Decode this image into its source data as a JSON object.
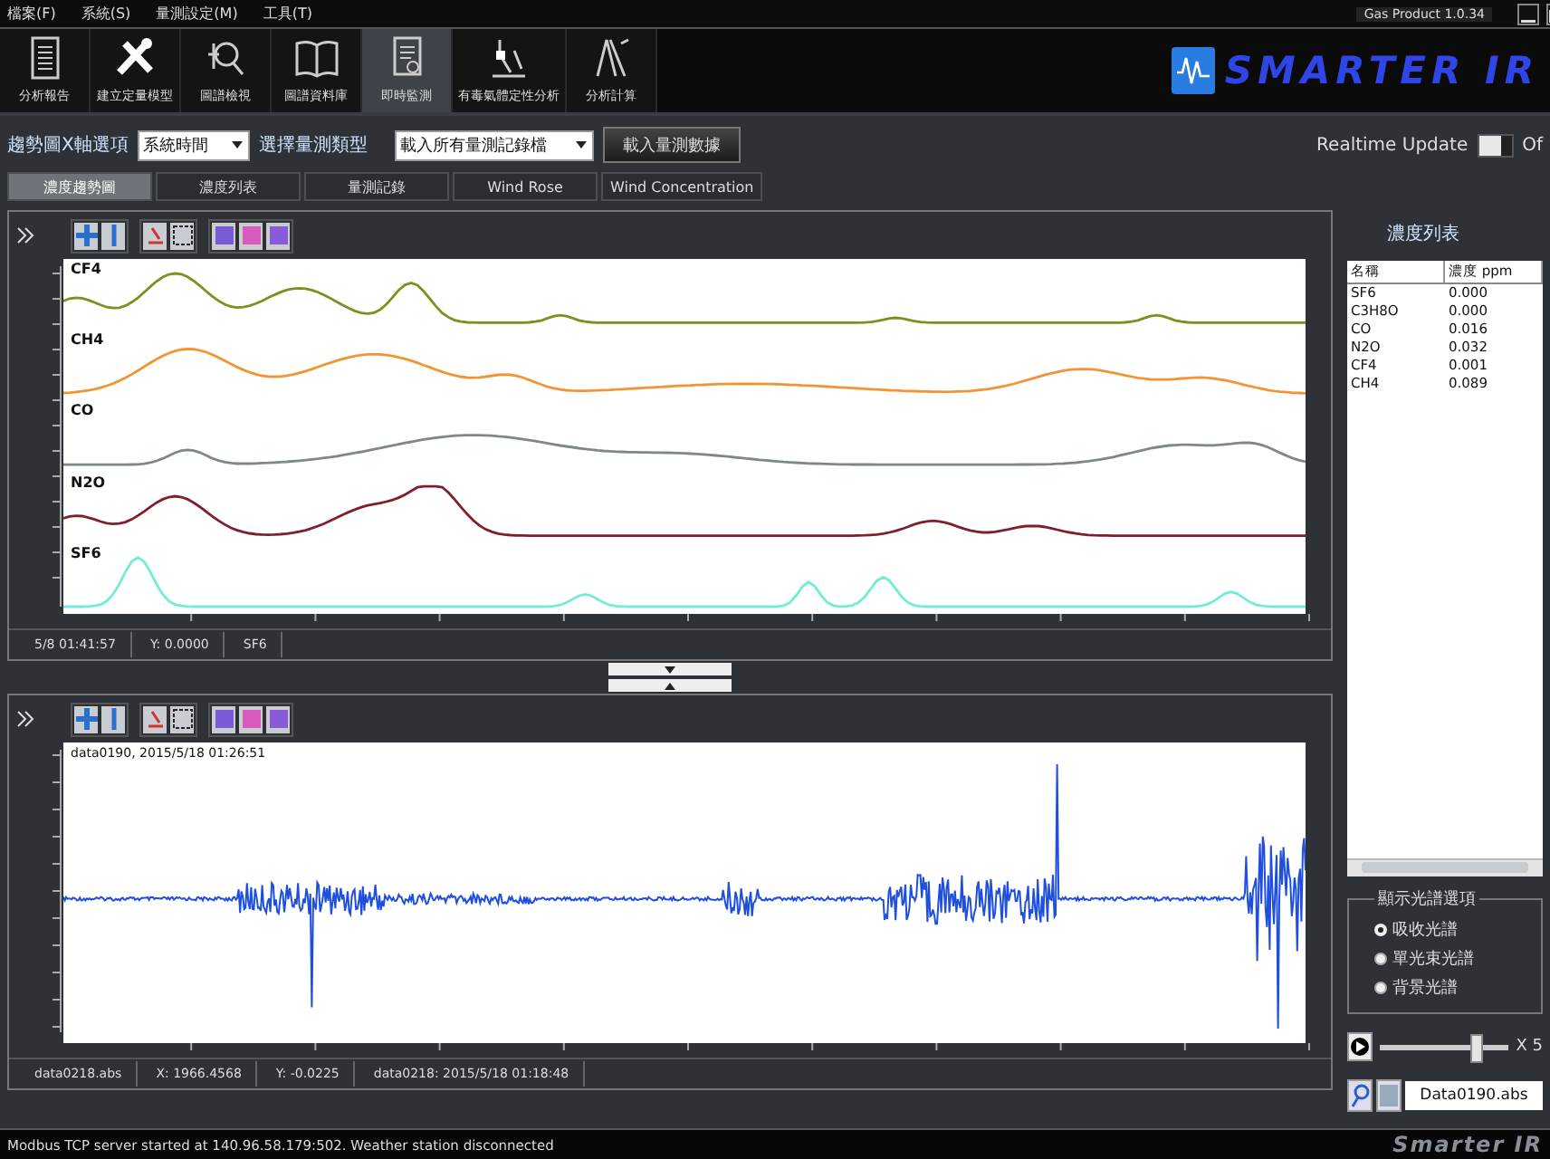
{
  "menu": [
    "檔案(F)",
    "系統(S)",
    "量測設定(M)",
    "工具(T)"
  ],
  "version": "Gas Product 1.0.34",
  "toolbar": [
    {
      "label": "分析報告",
      "selected": false
    },
    {
      "label": "建立定量模型",
      "selected": false
    },
    {
      "label": "圖譜檢視",
      "selected": false
    },
    {
      "label": "圖譜資料庫",
      "selected": false
    },
    {
      "label": "即時監測",
      "selected": true
    },
    {
      "label": "有毒氣體定性分析",
      "selected": false
    },
    {
      "label": "分析計算",
      "selected": false
    }
  ],
  "logo": "SMARTER IR",
  "controls": {
    "x_axis_label": "趨勢圖X軸選項",
    "x_axis_value": "系統時間",
    "type_label": "選擇量測類型",
    "type_value": "載入所有量測記錄檔",
    "load_button": "載入量測數據"
  },
  "realtime": {
    "label": "Realtime Update",
    "on": false,
    "state_text": "Of"
  },
  "tabs": [
    {
      "label": "濃度趨勢圖",
      "selected": true
    },
    {
      "label": "濃度列表",
      "selected": false
    },
    {
      "label": "量測記錄",
      "selected": false
    },
    {
      "label": "Wind Rose",
      "selected": false
    },
    {
      "label": "Wind Concentration",
      "selected": false
    }
  ],
  "trend_chart": {
    "series": [
      {
        "name": "CF4",
        "color": "#7f8f1f"
      },
      {
        "name": "CH4",
        "color": "#f39433"
      },
      {
        "name": "CO",
        "color": "#7f8788"
      },
      {
        "name": "N2O",
        "color": "#7f1f2a"
      },
      {
        "name": "SF6",
        "color": "#72ecd4"
      }
    ],
    "status": [
      "5/8 01:41:57",
      "Y: 0.0000",
      "SF6"
    ]
  },
  "spectrum_chart": {
    "legend": "data0190, 2015/5/18 01:26:51",
    "status": [
      "data0218.abs",
      "X: 1966.4568",
      "Y: -0.0225",
      "data0218: 2015/5/18 01:18:48"
    ]
  },
  "concentration_list": {
    "title": "濃度列表",
    "columns": [
      "名稱",
      "濃度 ppm"
    ],
    "rows": [
      [
        "SF6",
        "0.000"
      ],
      [
        "C3H8O",
        "0.000"
      ],
      [
        "CO",
        "0.016"
      ],
      [
        "N2O",
        "0.032"
      ],
      [
        "CF4",
        "0.001"
      ],
      [
        "CH4",
        "0.089"
      ]
    ]
  },
  "spectrum_options": {
    "title": "顯示光譜選項",
    "options": [
      {
        "label": "吸收光譜",
        "selected": true
      },
      {
        "label": "單光束光譜",
        "selected": false
      },
      {
        "label": "背景光譜",
        "selected": false
      }
    ]
  },
  "playback": {
    "speed": "X 5",
    "level": 0.75
  },
  "file": "Data0190.abs",
  "status_bar": "Modbus TCP server started at 140.96.58.179:502. Weather station disconnected",
  "footer_logo": "Smarter IR"
}
